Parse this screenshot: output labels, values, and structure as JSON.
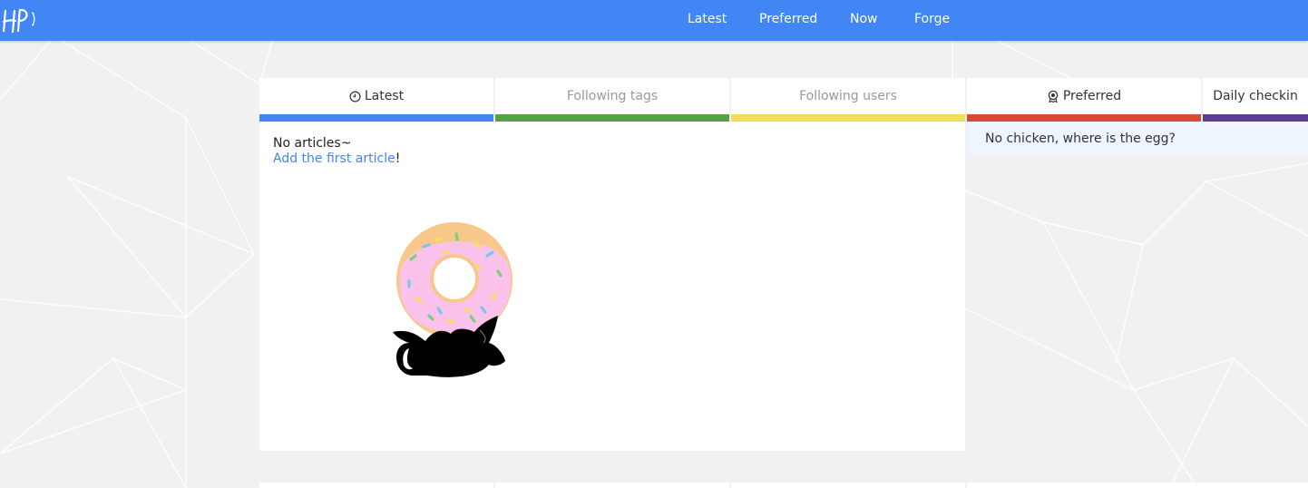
{
  "brand": {
    "logo_text": "HP"
  },
  "nav": {
    "links": [
      {
        "label": "Latest"
      },
      {
        "label": "Preferred"
      },
      {
        "label": "Now"
      },
      {
        "label": "Forge"
      }
    ]
  },
  "tabs": [
    {
      "label": "Latest",
      "icon": "clock-icon",
      "active": true,
      "color": "#4285f4"
    },
    {
      "label": "Following tags",
      "active": false,
      "color": "#58a144"
    },
    {
      "label": "Following users",
      "active": false,
      "color": "#f1df58"
    },
    {
      "label": "Preferred",
      "icon": "badge-icon",
      "active": true,
      "color": "#d94a36"
    },
    {
      "label": "Daily checkin",
      "active": true,
      "color": "#5b3f8c"
    }
  ],
  "main": {
    "empty_title": "No articles~",
    "add_link": "Add the first article",
    "add_suffix": "!"
  },
  "side": {
    "message": "No chicken, where is the egg?"
  },
  "colors": {
    "navbar": "#4285f4",
    "link": "#4285f4",
    "donut_icing": "#fbc3ec",
    "donut_dough": "#f7c88a"
  }
}
